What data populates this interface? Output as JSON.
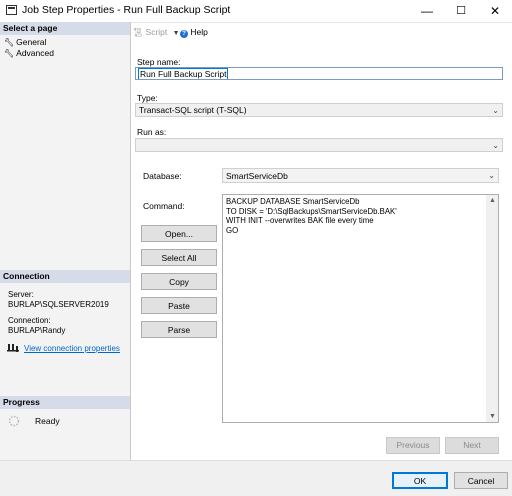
{
  "window": {
    "title": "Job Step Properties - Run Full Backup Script",
    "minimize_glyph": "—",
    "maximize_glyph": "☐",
    "close_glyph": "✕"
  },
  "sidebar": {
    "select_page_header": "Select a page",
    "pages": [
      {
        "label": "General",
        "icon": "wrench-icon"
      },
      {
        "label": "Advanced",
        "icon": "wrench-icon"
      }
    ],
    "connection_header": "Connection",
    "server_label": "Server:",
    "server_value": "BURLAP\\SQLSERVER2019",
    "connection_label": "Connection:",
    "connection_value": "BURLAP\\Randy",
    "view_connection_link": "View connection properties",
    "progress_header": "Progress",
    "progress_status": "Ready"
  },
  "toolbar": {
    "script_label": "Script",
    "help_label": "Help"
  },
  "form": {
    "step_name_label": "Step name:",
    "step_name_value": "Run Full Backup Script",
    "type_label": "Type:",
    "type_value": "Transact-SQL script (T-SQL)",
    "run_as_label": "Run as:",
    "run_as_value": "",
    "database_label": "Database:",
    "database_value": "SmartServiceDb",
    "command_label": "Command:",
    "command_lines": [
      "BACKUP DATABASE SmartServiceDb",
      "TO DISK = 'D:\\SqlBackups\\SmartServiceDb.BAK'",
      "WITH INIT --overwrites BAK file every time",
      "GO"
    ],
    "buttons": {
      "open": "Open...",
      "select_all": "Select All",
      "copy": "Copy",
      "paste": "Paste",
      "parse": "Parse"
    },
    "previous_label": "Previous",
    "next_label": "Next"
  },
  "footer": {
    "ok_label": "OK",
    "cancel_label": "Cancel"
  },
  "colors": {
    "section_header": "#d6dbe9",
    "link": "#0066cc",
    "focus_border": "#0078d7"
  }
}
